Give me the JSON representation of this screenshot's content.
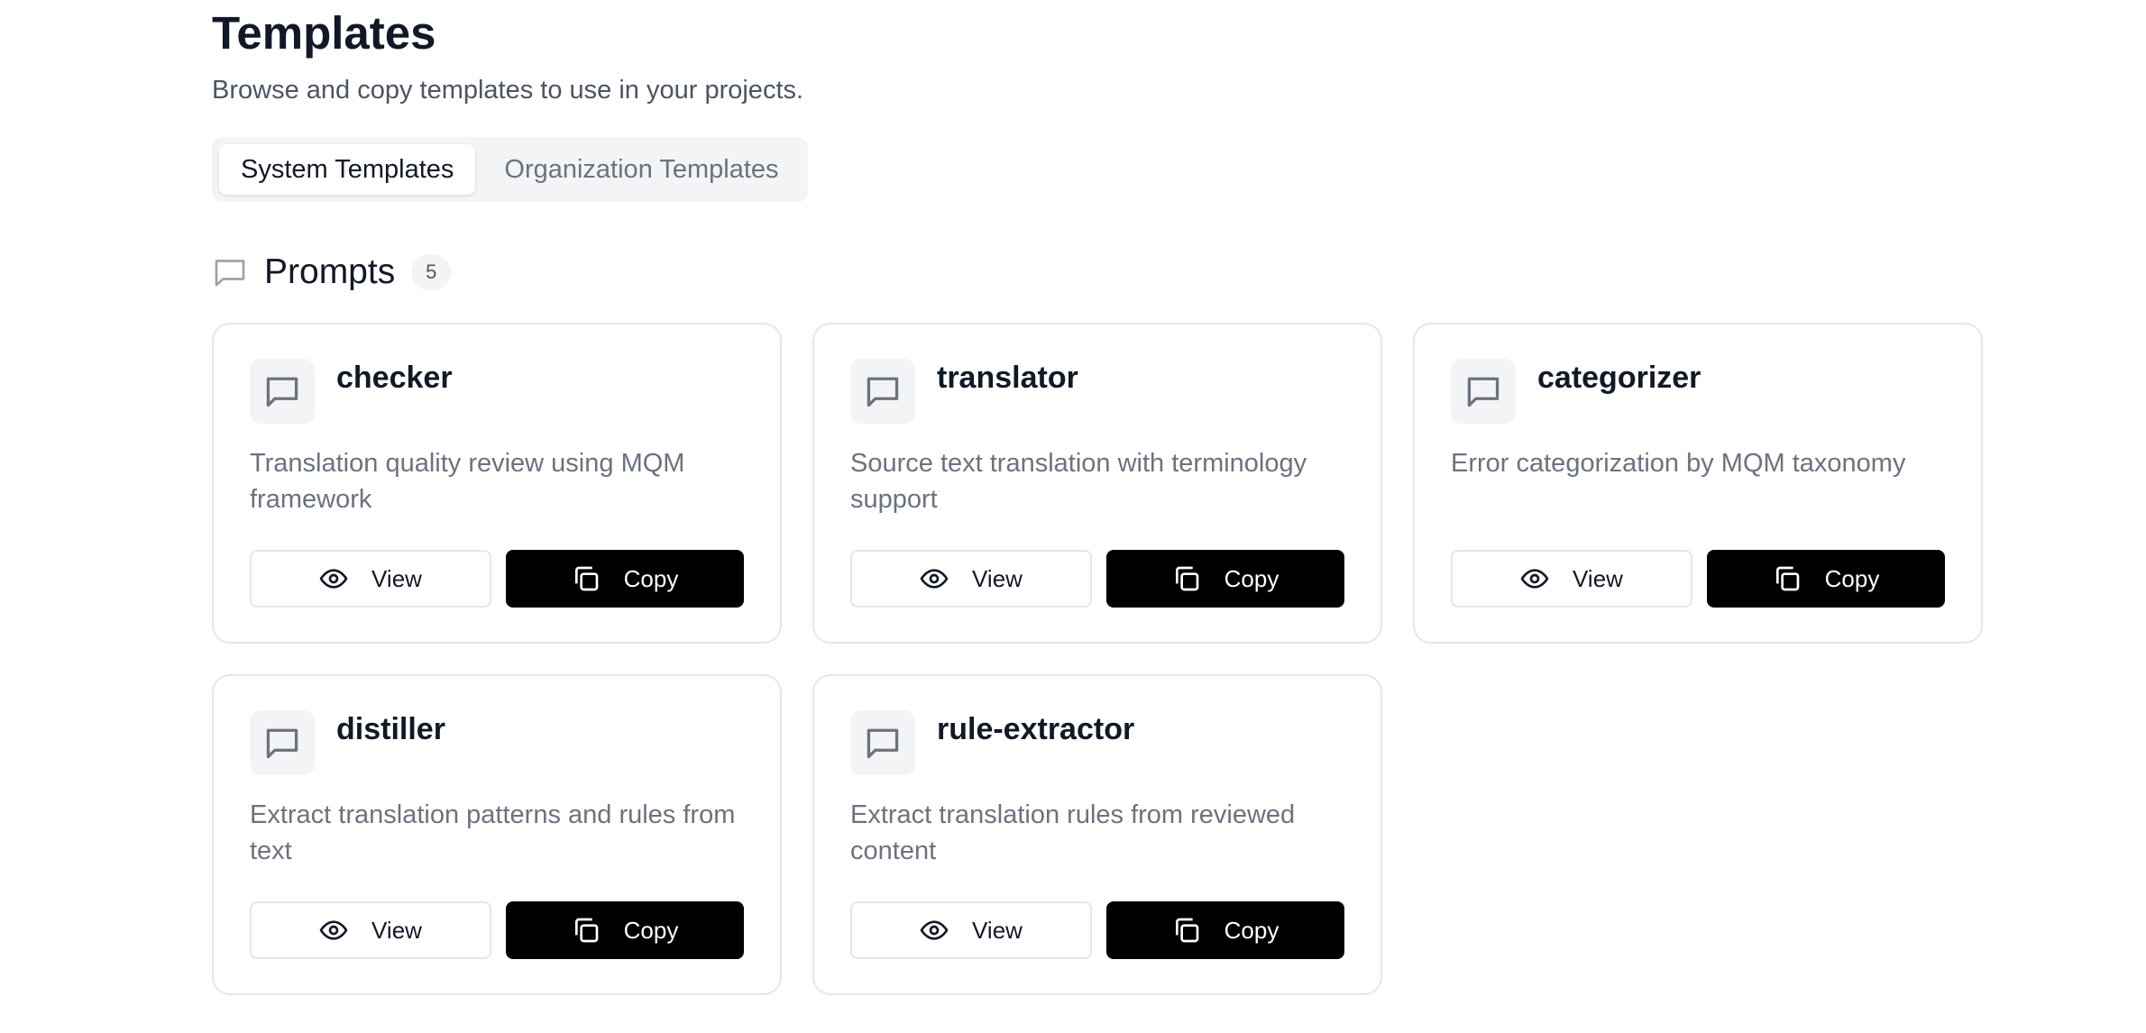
{
  "header": {
    "title": "Templates",
    "subtitle": "Browse and copy templates to use in your projects."
  },
  "tabs": [
    {
      "label": "System Templates",
      "active": true
    },
    {
      "label": "Organization Templates",
      "active": false
    }
  ],
  "section": {
    "icon": "message-square-icon",
    "title": "Prompts",
    "count": "5"
  },
  "cards": [
    {
      "title": "checker",
      "description": "Translation quality review using MQM framework",
      "icon": "message-square-icon",
      "view_label": "View",
      "copy_label": "Copy"
    },
    {
      "title": "translator",
      "description": "Source text translation with terminology support",
      "icon": "message-square-icon",
      "view_label": "View",
      "copy_label": "Copy"
    },
    {
      "title": "categorizer",
      "description": "Error categorization by MQM taxonomy",
      "icon": "message-square-icon",
      "view_label": "View",
      "copy_label": "Copy"
    },
    {
      "title": "distiller",
      "description": "Extract translation patterns and rules from text",
      "icon": "message-square-icon",
      "view_label": "View",
      "copy_label": "Copy"
    },
    {
      "title": "rule-extractor",
      "description": "Extract translation rules from reviewed content",
      "icon": "message-square-icon",
      "view_label": "View",
      "copy_label": "Copy"
    }
  ],
  "colors": {
    "copy_button_bg": "#000000",
    "muted_text": "#6b7280",
    "border": "#e5e7eb"
  }
}
